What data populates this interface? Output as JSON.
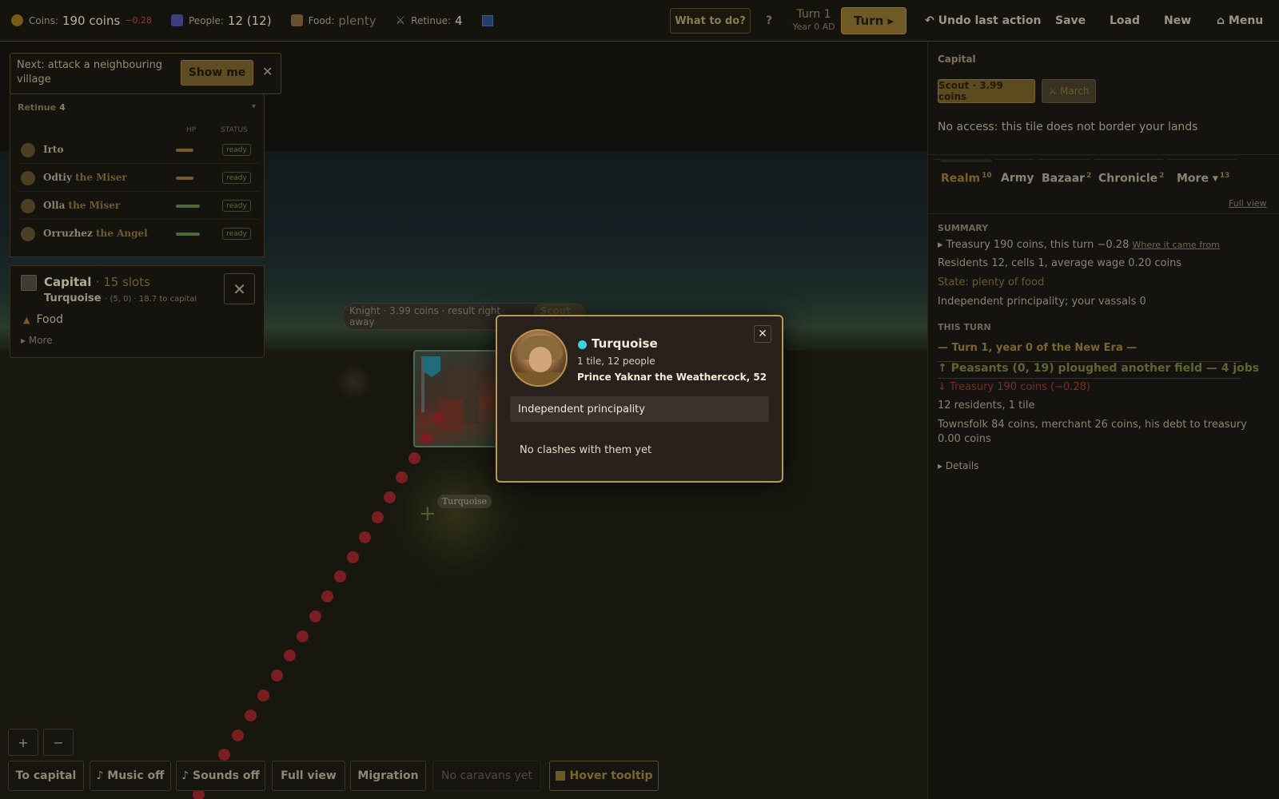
{
  "topbar": {
    "coins_label": "Coins:",
    "coins_value": "190 coins",
    "coins_delta": "−0.28",
    "people_label": "People:",
    "people_value": "12 (12)",
    "food_label": "Food:",
    "food_value": "plenty",
    "retinue_label": "Retinue:",
    "retinue_value": "4",
    "what_to_do": "What to do?",
    "help": "?",
    "turn_label": "Turn 1",
    "year_label": "Year 0 AD",
    "turn_button": "Turn ▸",
    "undo": "↶ Undo last action",
    "save": "Save",
    "load": "Load",
    "new": "New",
    "menu": "⌂ Menu"
  },
  "next_hint": {
    "text": "Next: attack a neighbouring village",
    "show_me": "Show me",
    "close": "✕"
  },
  "retinue": {
    "title": "Retinue",
    "count": "4",
    "col_hp": "HP",
    "col_status": "STATUS",
    "members": [
      {
        "name": "Irto",
        "epithet": "",
        "hp": 0.55,
        "status": "ready"
      },
      {
        "name": "Odtiy",
        "epithet": "the Miser",
        "hp": 0.55,
        "status": "ready"
      },
      {
        "name": "Olla",
        "epithet": "the Miser",
        "hp": 0.75,
        "status": "ready"
      },
      {
        "name": "Orruzhez",
        "epithet": "the Angel",
        "hp": 0.75,
        "status": "ready"
      }
    ]
  },
  "capital_card": {
    "title": "Capital",
    "slots": "· 15 slots",
    "subtitle": "Turquoise",
    "location": "· (5, 0) · 18.7 to capital",
    "food": "Food",
    "more": "▸ More",
    "close": "✕"
  },
  "map": {
    "knight_tip": "Knight · 3.99 coins · result right away",
    "knight_scout": "Scout ▸",
    "city_label": "Turquoise",
    "plus_marker": "+"
  },
  "popup": {
    "name": "Turquoise",
    "status_color": "#3fd0e0",
    "meta": "1 tile, 12 people",
    "ruler": "Prince Yaknar the Weathercock, 52",
    "type": "Independent principality",
    "clashes": "No clashes with them yet",
    "close": "✕"
  },
  "sidebar": {
    "capital_heading": "Capital",
    "scout_button": "Scout · 3.99 coins",
    "march_button": "⚔ March",
    "no_access": "No access: this tile does not border your lands",
    "tabs": [
      {
        "label": "Realm",
        "badge": "10"
      },
      {
        "label": "Army",
        "badge": ""
      },
      {
        "label": "Bazaar",
        "badge": "2"
      },
      {
        "label": "Chronicle",
        "badge": "2"
      },
      {
        "label": "More ▾",
        "badge": "13"
      }
    ],
    "full_view": "Full view",
    "summary_heading": "SUMMARY",
    "summary_treasury": "▸ Treasury 190 coins, this turn −0.28",
    "summary_where": "Where it came from",
    "summary_residents": "Residents 12, cells 1, average wage 0.20 coins",
    "summary_state": "State: plenty of food",
    "summary_independent": "Independent principality; your vassals 0",
    "this_turn_heading": "THIS TURN",
    "turn_line": "— Turn 1, year 0 of the New Era —",
    "peasants_line": "↑ Peasants (0, 19) ploughed another field — 4 jobs",
    "treasury_line": "↓ Treasury 190 coins (−0.28)",
    "residents_line": "12 residents, 1 tile",
    "townsfolk_line": "Townsfolk 84 coins, merchant 26 coins, his debt to treasury 0.00 coins",
    "details": "▸ Details"
  },
  "bottom": {
    "zoom_in": "+",
    "zoom_out": "−",
    "to_capital": "To capital",
    "music": "♪ Music off",
    "sounds": "♪ Sounds off",
    "full_view": "Full view",
    "migration": "Migration",
    "caravans": "No caravans yet",
    "hover": "Hover tooltip"
  }
}
